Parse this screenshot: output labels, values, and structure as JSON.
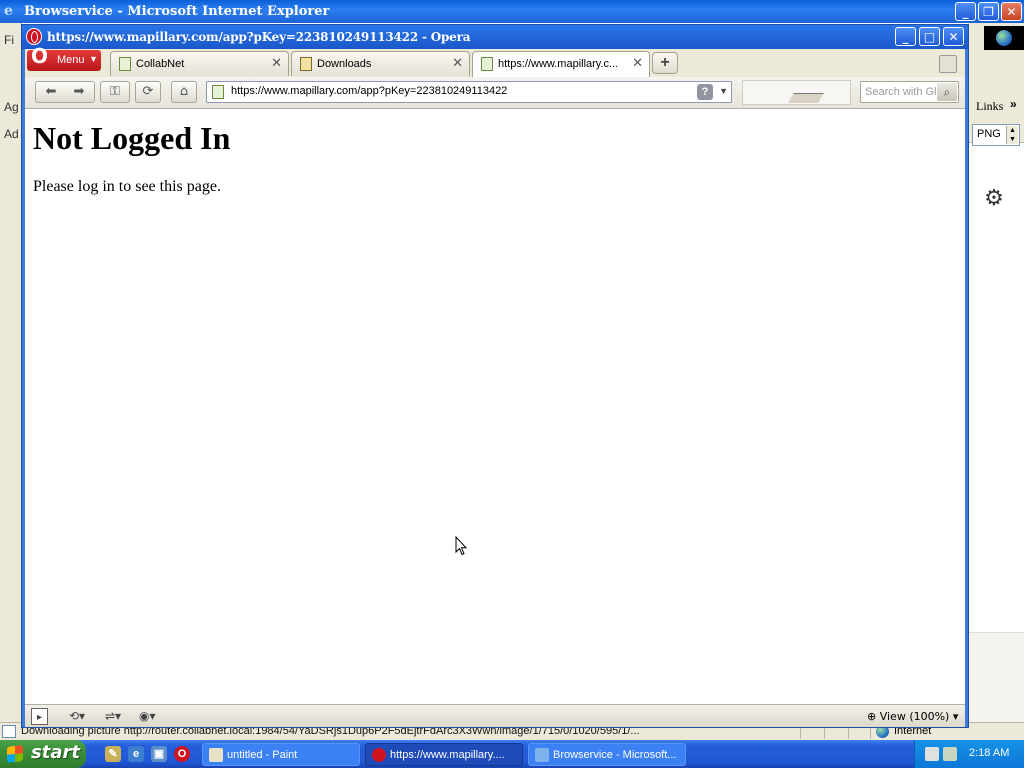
{
  "ie": {
    "title": "Browservice - Microsoft Internet Explorer",
    "left_fragments": [
      "Fi",
      "Ag",
      "Ad"
    ],
    "links_label": "Links",
    "links_chevron": "»",
    "image_format": "PNG",
    "status_text": "Downloading picture http://router.collabnet.local:1984/54/YaDSRjs1Dup6P2F5dEjtrFdArc3X3Wwn/image/1/715/0/1020/595/1/...",
    "status_zone": "Internet"
  },
  "opera": {
    "title": "https://www.mapillary.com/app?pKey=223810249113422 - Opera",
    "menu_label": "Menu",
    "tabs": [
      {
        "label": "CollabNet"
      },
      {
        "label": "Downloads"
      },
      {
        "label": "https://www.mapillary.c..."
      }
    ],
    "address": "https://www.mapillary.com/app?pKey=223810249113422",
    "search_placeholder": "Search with Gl",
    "zoom_label": "View (100%)"
  },
  "page": {
    "heading": "Not Logged In",
    "message": "Please log in to see this page."
  },
  "taskbar": {
    "start_label": "start",
    "tasks": [
      {
        "label": "untitled - Paint"
      },
      {
        "label": "https://www.mapillary...."
      },
      {
        "label": "Browservice - Microsoft..."
      }
    ],
    "clock": "2:18 AM"
  }
}
